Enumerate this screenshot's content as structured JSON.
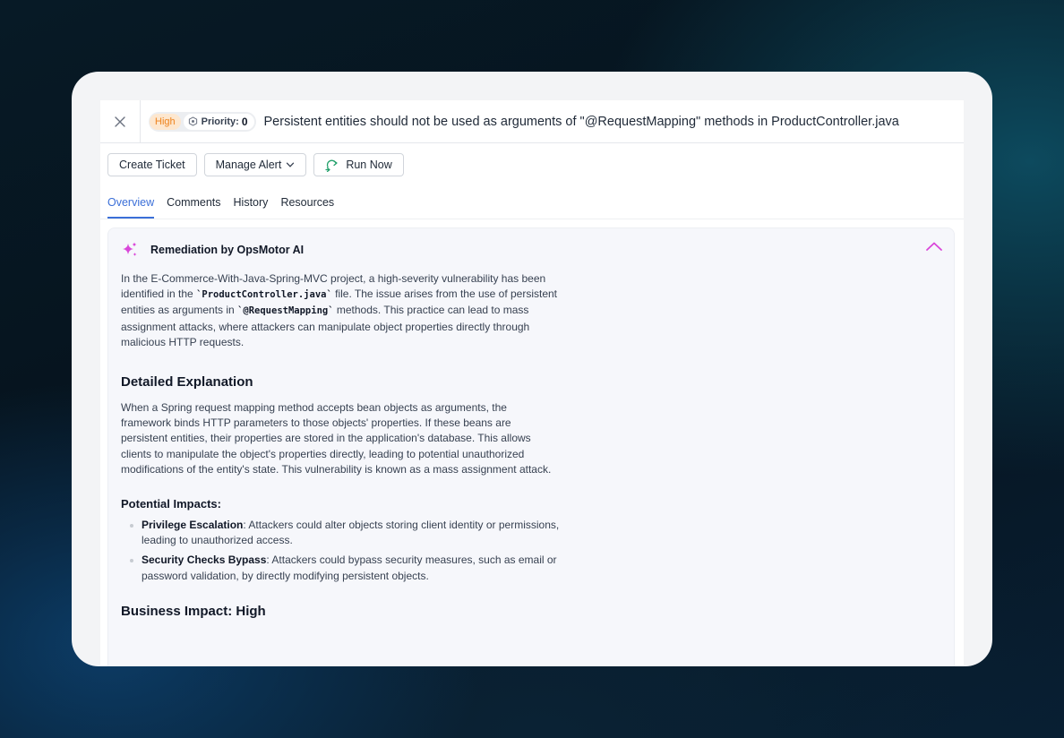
{
  "header": {
    "severity": "High",
    "priority_label": "Priority:",
    "priority_value": "0",
    "title": "Persistent entities should not be used as arguments of \"@RequestMapping\" methods in ProductController.java"
  },
  "actions": {
    "create_ticket": "Create Ticket",
    "manage_alert": "Manage Alert",
    "run_now": "Run Now"
  },
  "tabs": [
    {
      "label": "Overview",
      "active": true
    },
    {
      "label": "Comments",
      "active": false
    },
    {
      "label": "History",
      "active": false
    },
    {
      "label": "Resources",
      "active": false
    }
  ],
  "remediation": {
    "title": "Remediation by OpsMotor AI",
    "intro": {
      "t1": "In the E-Commerce-With-Java-Spring-MVC project, a high-severity vulnerability has been identified in the ",
      "code1": "`ProductController.java`",
      "t2": " file. The issue arises from the use of persistent entities as arguments in ",
      "code2": "`@RequestMapping`",
      "t3": " methods. This practice can lead to mass assignment attacks, where attackers can manipulate object properties directly through malicious HTTP requests."
    },
    "detailed_heading": "Detailed Explanation",
    "detailed_text": "When a Spring request mapping method accepts bean objects as arguments, the framework binds HTTP parameters to those objects' properties. If these beans are persistent entities, their properties are stored in the application's database. This allows clients to manipulate the object's properties directly, leading to potential unauthorized modifications of the entity's state. This vulnerability is known as a mass assignment attack.",
    "impacts_heading": "Potential Impacts:",
    "impacts": [
      {
        "term": "Privilege Escalation",
        "text": ": Attackers could alter objects storing client identity or permissions, leading to unauthorized access."
      },
      {
        "term": "Security Checks Bypass",
        "text": ": Attackers could bypass security measures, such as email or password validation, by directly modifying persistent objects."
      }
    ],
    "business_heading": "Business Impact: High"
  },
  "colors": {
    "accent": "#3b6fd8",
    "ai_magenta": "#d946d9",
    "severity_high": "#ef8a2a"
  }
}
